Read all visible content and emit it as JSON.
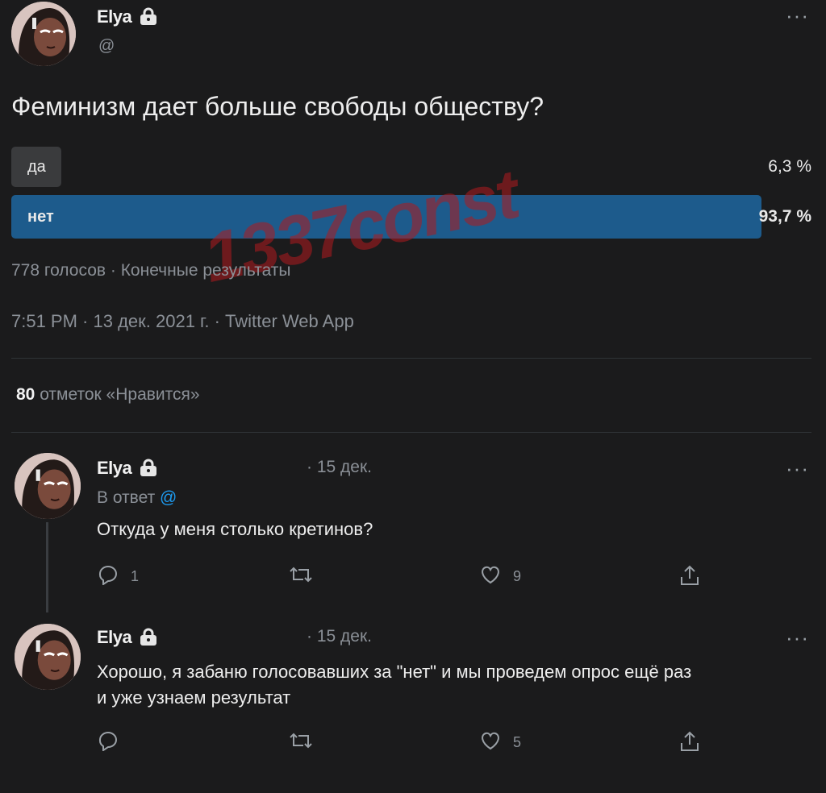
{
  "tweet": {
    "author": "Elya",
    "handle": "@",
    "question": "Феминизм дает больше свободы обществу?",
    "poll": {
      "options": [
        {
          "label": "да",
          "percent_text": "6,3 %",
          "fraction": 0.063
        },
        {
          "label": "нет",
          "percent_text": "93,7 %",
          "fraction": 0.937
        }
      ],
      "meta": "778 голосов · Конечные результаты"
    },
    "timestamp": "7:51 PM · 13 дек. 2021 г. · Twitter Web App",
    "likes_count": "80",
    "likes_label": "отметок «Нравится»"
  },
  "watermark": "1337const",
  "replies": [
    {
      "author": "Elya",
      "date": "· 15 дек.",
      "reply_prefix": "В ответ",
      "reply_to": "@",
      "text": "Откуда у меня столько кретинов?",
      "reply_count": "1",
      "like_count": "9"
    },
    {
      "author": "Elya",
      "date": "· 15 дек.",
      "text_line1": "Хорошо, я забаню голосовавших за \"нет\" и мы проведем опрос ещё раз",
      "text_line2": "и уже узнаем результат",
      "like_count": "5"
    }
  ],
  "colors": {
    "background": "#1b1b1c",
    "poll_winner": "#1d5b8c",
    "poll_loser": "#3a3b3d",
    "link": "#1d9bf0",
    "watermark": "#b01a1f"
  },
  "icons": [
    "lock-icon",
    "more-icon",
    "reply-icon",
    "retweet-icon",
    "like-icon",
    "share-icon"
  ]
}
